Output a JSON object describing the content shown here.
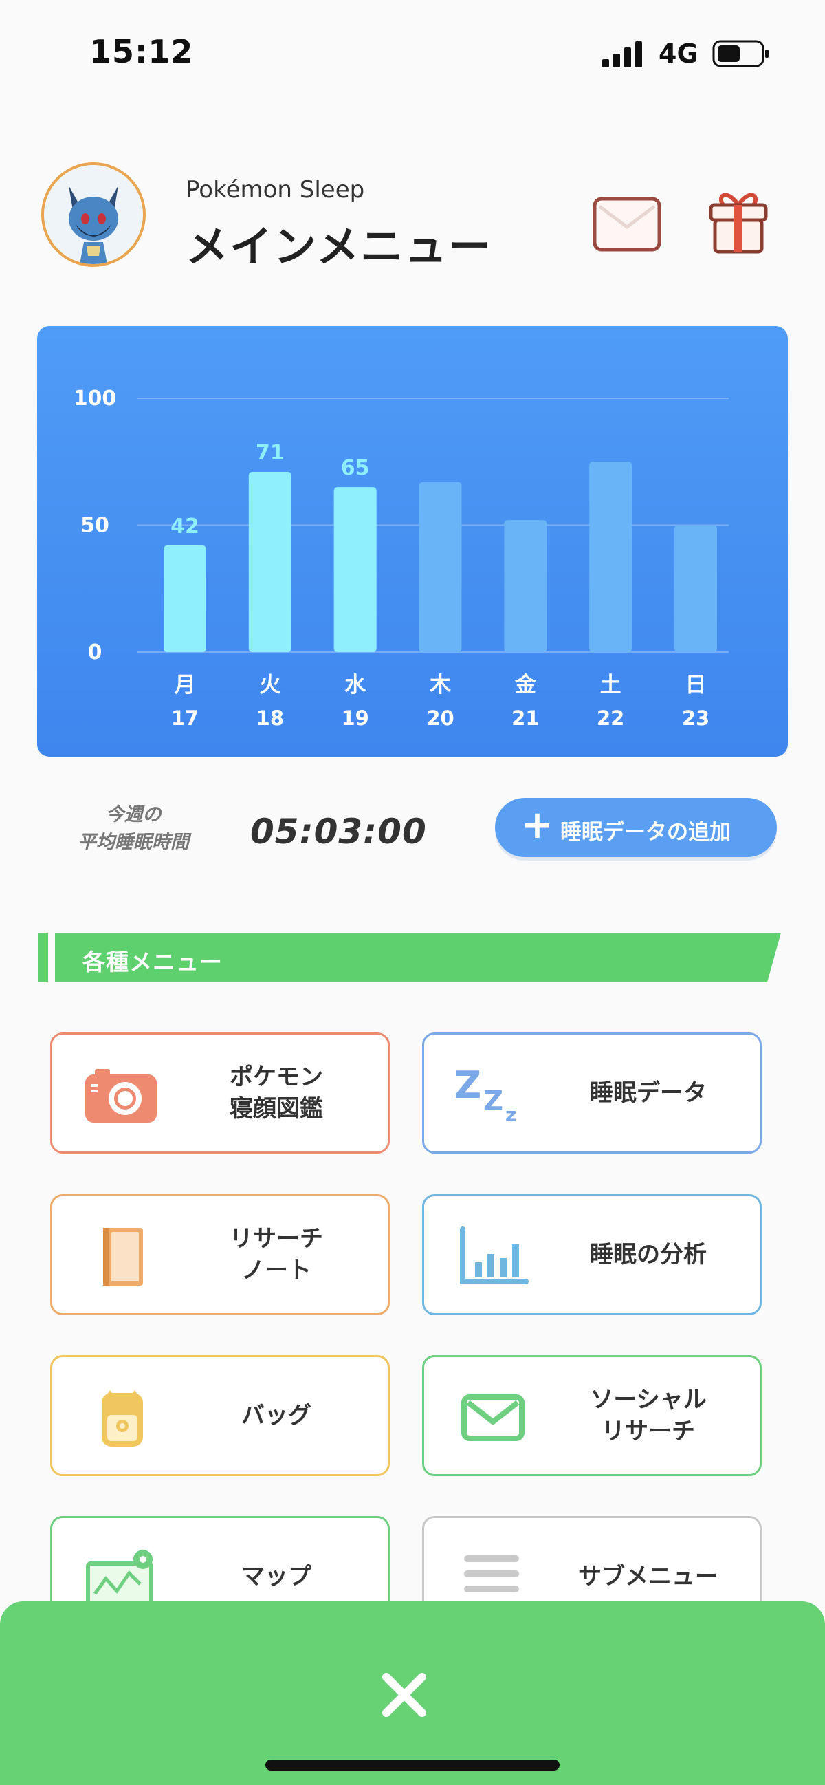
{
  "status_bar": {
    "time": "15:12",
    "network": "4G"
  },
  "header": {
    "app_name": "Pokémon Sleep",
    "title": "メインメニュー"
  },
  "chart_data": {
    "type": "bar",
    "categories": [
      "月",
      "火",
      "水",
      "木",
      "金",
      "土",
      "日"
    ],
    "dates": [
      "17",
      "18",
      "19",
      "20",
      "21",
      "22",
      "23"
    ],
    "values": [
      42,
      71,
      65,
      67,
      52,
      75,
      50
    ],
    "data_labels": [
      "42",
      "71",
      "65",
      "",
      "",
      "",
      ""
    ],
    "highlighted": [
      true,
      true,
      true,
      false,
      false,
      false,
      false
    ],
    "yticks": [
      "0",
      "50",
      "100"
    ],
    "ylim": [
      0,
      100
    ],
    "grid": true,
    "colors": {
      "highlight": "#8ff0fb",
      "faded": "#68b4f6",
      "label": "#8ff0fb"
    }
  },
  "weekly_average": {
    "label": "今週の\n平均睡眠時間",
    "value": "05:03:00"
  },
  "add_sleep_button": {
    "label": "睡眠データの追加"
  },
  "section": {
    "title": "各種メニュー"
  },
  "menu": {
    "items": [
      {
        "label": "ポケモン\n寝顔図鑑",
        "icon": "camera-icon",
        "color": "#ee8a70"
      },
      {
        "label": "睡眠データ",
        "icon": "zzz-icon",
        "color": "#7ba9e8"
      },
      {
        "label": "リサーチ\nノート",
        "icon": "notebook-icon",
        "color": "#efab6a"
      },
      {
        "label": "睡眠の分析",
        "icon": "bar-chart-icon",
        "color": "#6fb7df"
      },
      {
        "label": "バッグ",
        "icon": "bag-icon",
        "color": "#f0c65f"
      },
      {
        "label": "ソーシャル\nリサーチ",
        "icon": "mail-icon",
        "color": "#6dcf7f"
      },
      {
        "label": "マップ",
        "icon": "map-icon",
        "color": "#6dcf7f"
      },
      {
        "label": "サブメニュー",
        "icon": "menu-lines-icon",
        "color": "#c9c9c9"
      }
    ]
  }
}
